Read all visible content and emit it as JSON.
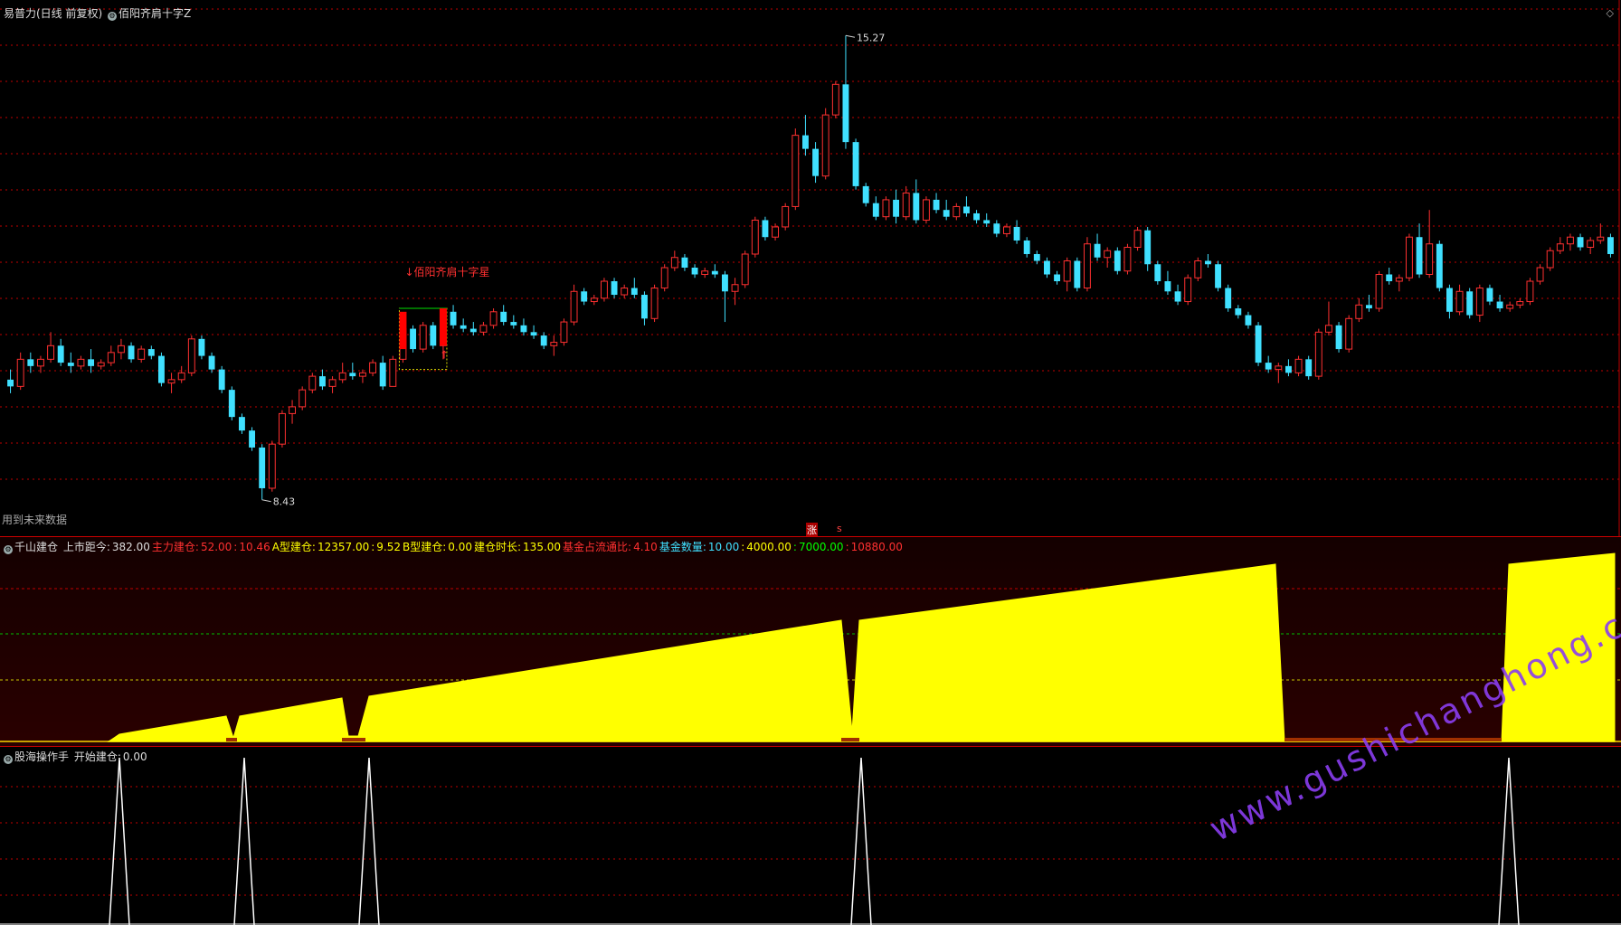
{
  "panel1": {
    "title": "易普力(日线 前复权)",
    "indicator": "佰阳齐肩十字Z",
    "future_note": "用到未来数据",
    "signal_label": "↓佰阳齐肩十字星",
    "high_label": "15.27",
    "low_label": "8.43",
    "zhang": "涨",
    "s_mark": "s"
  },
  "panel2": {
    "name": "千山建仓",
    "items": [
      {
        "label": "上市距今:",
        "value": "382.00",
        "color": "#dddddd"
      },
      {
        "label": "主力建仓:",
        "value": "52.00",
        "color": "#ff3030"
      },
      {
        "label": ":",
        "value": "10.46",
        "color": "#ff3030"
      },
      {
        "label": "A型建仓:",
        "value": "12357.00",
        "color": "#ffff00"
      },
      {
        "label": ":",
        "value": "9.52",
        "color": "#ffff00"
      },
      {
        "label": "B型建仓:",
        "value": "0.00",
        "color": "#ffff00"
      },
      {
        "label": "建仓时长:",
        "value": "135.00",
        "color": "#ffff00"
      },
      {
        "label": "基金占流通比:",
        "value": "4.10",
        "color": "#ff3030"
      },
      {
        "label": "基金数量:",
        "value": "10.00",
        "color": "#40e0ff"
      },
      {
        "label": ":",
        "value": "4000.00",
        "color": "#ffff00"
      },
      {
        "label": ":",
        "value": "7000.00",
        "color": "#00ff00"
      },
      {
        "label": ":",
        "value": "10880.00",
        "color": "#ff3030"
      }
    ]
  },
  "panel3": {
    "name": "股海操作手",
    "label": "开始建仓:",
    "value": "0.00"
  },
  "watermark": "www.gushichanghong.com",
  "colors": {
    "up": "#ff3030",
    "down": "#40e0ff",
    "fill": "#ffff00",
    "grid": "#c00000"
  },
  "chart_data": [
    {
      "type": "candlestick",
      "ylim": [
        8.2,
        15.5
      ],
      "annotations": [
        {
          "label": "15.27",
          "value": 15.27
        },
        {
          "label": "8.43",
          "value": 8.43
        }
      ],
      "candles": [
        [
          10.2,
          10.35,
          10.0,
          10.1
        ],
        [
          10.1,
          10.6,
          10.05,
          10.5
        ],
        [
          10.5,
          10.6,
          10.3,
          10.4
        ],
        [
          10.4,
          10.55,
          10.3,
          10.5
        ],
        [
          10.5,
          10.9,
          10.45,
          10.7
        ],
        [
          10.7,
          10.8,
          10.4,
          10.45
        ],
        [
          10.45,
          10.6,
          10.3,
          10.4
        ],
        [
          10.4,
          10.55,
          10.35,
          10.5
        ],
        [
          10.5,
          10.65,
          10.3,
          10.4
        ],
        [
          10.4,
          10.5,
          10.35,
          10.45
        ],
        [
          10.45,
          10.7,
          10.4,
          10.6
        ],
        [
          10.6,
          10.8,
          10.5,
          10.7
        ],
        [
          10.7,
          10.75,
          10.45,
          10.5
        ],
        [
          10.5,
          10.7,
          10.45,
          10.65
        ],
        [
          10.65,
          10.7,
          10.5,
          10.55
        ],
        [
          10.55,
          10.6,
          10.1,
          10.15
        ],
        [
          10.15,
          10.3,
          10.0,
          10.2
        ],
        [
          10.2,
          10.4,
          10.15,
          10.3
        ],
        [
          10.3,
          10.85,
          10.25,
          10.8
        ],
        [
          10.8,
          10.85,
          10.5,
          10.55
        ],
        [
          10.55,
          10.6,
          10.3,
          10.35
        ],
        [
          10.35,
          10.4,
          10.0,
          10.05
        ],
        [
          10.05,
          10.1,
          9.6,
          9.65
        ],
        [
          9.65,
          9.7,
          9.4,
          9.45
        ],
        [
          9.45,
          9.5,
          9.15,
          9.2
        ],
        [
          9.2,
          9.25,
          8.43,
          8.6
        ],
        [
          8.6,
          9.3,
          8.55,
          9.25
        ],
        [
          9.25,
          9.75,
          9.2,
          9.7
        ],
        [
          9.7,
          9.9,
          9.55,
          9.8
        ],
        [
          9.8,
          10.1,
          9.75,
          10.05
        ],
        [
          10.05,
          10.3,
          10.0,
          10.25
        ],
        [
          10.25,
          10.35,
          10.05,
          10.1
        ],
        [
          10.1,
          10.25,
          10.0,
          10.2
        ],
        [
          10.2,
          10.45,
          10.15,
          10.3
        ],
        [
          10.3,
          10.45,
          10.2,
          10.25
        ],
        [
          10.25,
          10.35,
          10.15,
          10.3
        ],
        [
          10.3,
          10.5,
          10.25,
          10.45
        ],
        [
          10.45,
          10.55,
          10.05,
          10.1
        ],
        [
          10.1,
          10.55,
          10.1,
          10.5
        ],
        [
          10.5,
          11.0,
          10.45,
          10.95
        ],
        [
          10.95,
          11.0,
          10.6,
          10.65
        ],
        [
          10.65,
          11.05,
          10.6,
          11.0
        ],
        [
          11.0,
          11.05,
          10.65,
          10.7
        ],
        [
          10.7,
          11.25,
          10.5,
          11.2
        ],
        [
          11.2,
          11.3,
          10.95,
          11.0
        ],
        [
          11.0,
          11.1,
          10.9,
          10.95
        ],
        [
          10.95,
          11.05,
          10.85,
          10.9
        ],
        [
          10.9,
          11.05,
          10.85,
          11.0
        ],
        [
          11.0,
          11.25,
          10.95,
          11.2
        ],
        [
          11.2,
          11.3,
          11.0,
          11.05
        ],
        [
          11.05,
          11.15,
          10.95,
          11.0
        ],
        [
          11.0,
          11.1,
          10.85,
          10.9
        ],
        [
          10.9,
          11.0,
          10.8,
          10.85
        ],
        [
          10.85,
          10.9,
          10.65,
          10.7
        ],
        [
          10.7,
          10.85,
          10.55,
          10.75
        ],
        [
          10.75,
          11.1,
          10.7,
          11.05
        ],
        [
          11.05,
          11.6,
          11.0,
          11.5
        ],
        [
          11.5,
          11.55,
          11.3,
          11.35
        ],
        [
          11.35,
          11.45,
          11.3,
          11.4
        ],
        [
          11.4,
          11.7,
          11.35,
          11.65
        ],
        [
          11.65,
          11.7,
          11.4,
          11.45
        ],
        [
          11.45,
          11.6,
          11.4,
          11.55
        ],
        [
          11.55,
          11.7,
          11.4,
          11.45
        ],
        [
          11.45,
          11.5,
          11.0,
          11.1
        ],
        [
          11.1,
          11.6,
          11.05,
          11.55
        ],
        [
          11.55,
          11.9,
          11.5,
          11.85
        ],
        [
          11.85,
          12.1,
          11.8,
          12.0
        ],
        [
          12.0,
          12.05,
          11.8,
          11.85
        ],
        [
          11.85,
          11.9,
          11.7,
          11.75
        ],
        [
          11.75,
          11.85,
          11.7,
          11.8
        ],
        [
          11.8,
          11.9,
          11.7,
          11.75
        ],
        [
          11.75,
          11.8,
          11.05,
          11.5
        ],
        [
          11.5,
          11.7,
          11.3,
          11.6
        ],
        [
          11.6,
          12.1,
          11.55,
          12.05
        ],
        [
          12.05,
          12.6,
          12.0,
          12.55
        ],
        [
          12.55,
          12.6,
          12.25,
          12.3
        ],
        [
          12.3,
          12.5,
          12.25,
          12.45
        ],
        [
          12.45,
          12.8,
          12.4,
          12.75
        ],
        [
          12.75,
          13.9,
          12.7,
          13.8
        ],
        [
          13.8,
          14.1,
          13.5,
          13.6
        ],
        [
          13.6,
          13.7,
          13.1,
          13.2
        ],
        [
          13.2,
          14.2,
          13.15,
          14.1
        ],
        [
          14.1,
          14.6,
          14.05,
          14.55
        ],
        [
          14.55,
          15.27,
          13.6,
          13.7
        ],
        [
          13.7,
          13.75,
          13.0,
          13.05
        ],
        [
          13.05,
          13.1,
          12.75,
          12.8
        ],
        [
          12.8,
          12.9,
          12.55,
          12.6
        ],
        [
          12.6,
          12.9,
          12.55,
          12.85
        ],
        [
          12.85,
          13.0,
          12.5,
          12.6
        ],
        [
          12.6,
          13.05,
          12.55,
          12.95
        ],
        [
          12.95,
          13.15,
          12.5,
          12.55
        ],
        [
          12.55,
          12.9,
          12.5,
          12.85
        ],
        [
          12.85,
          12.95,
          12.65,
          12.7
        ],
        [
          12.7,
          12.85,
          12.55,
          12.6
        ],
        [
          12.6,
          12.8,
          12.55,
          12.75
        ],
        [
          12.75,
          12.9,
          12.6,
          12.65
        ],
        [
          12.65,
          12.7,
          12.5,
          12.55
        ],
        [
          12.55,
          12.65,
          12.45,
          12.5
        ],
        [
          12.5,
          12.55,
          12.3,
          12.35
        ],
        [
          12.35,
          12.5,
          12.3,
          12.45
        ],
        [
          12.45,
          12.55,
          12.2,
          12.25
        ],
        [
          12.25,
          12.3,
          12.0,
          12.05
        ],
        [
          12.05,
          12.1,
          11.9,
          11.95
        ],
        [
          11.95,
          12.0,
          11.7,
          11.75
        ],
        [
          11.75,
          11.8,
          11.6,
          11.65
        ],
        [
          11.65,
          12.0,
          11.5,
          11.95
        ],
        [
          11.95,
          12.0,
          11.5,
          11.55
        ],
        [
          11.55,
          12.3,
          11.5,
          12.2
        ],
        [
          12.2,
          12.35,
          11.95,
          12.0
        ],
        [
          12.0,
          12.15,
          11.85,
          12.1
        ],
        [
          12.1,
          12.15,
          11.75,
          11.8
        ],
        [
          11.8,
          12.2,
          11.75,
          12.15
        ],
        [
          12.15,
          12.45,
          12.1,
          12.4
        ],
        [
          12.4,
          12.45,
          11.8,
          11.9
        ],
        [
          11.9,
          11.95,
          11.6,
          11.65
        ],
        [
          11.65,
          11.8,
          11.45,
          11.5
        ],
        [
          11.5,
          11.6,
          11.3,
          11.35
        ],
        [
          11.35,
          11.75,
          11.3,
          11.7
        ],
        [
          11.7,
          12.0,
          11.65,
          11.95
        ],
        [
          11.95,
          12.05,
          11.85,
          11.9
        ],
        [
          11.9,
          11.95,
          11.5,
          11.55
        ],
        [
          11.55,
          11.6,
          11.2,
          11.25
        ],
        [
          11.25,
          11.3,
          11.1,
          11.15
        ],
        [
          11.15,
          11.2,
          10.95,
          11.0
        ],
        [
          11.0,
          11.05,
          10.4,
          10.45
        ],
        [
          10.45,
          10.55,
          10.3,
          10.35
        ],
        [
          10.35,
          10.45,
          10.15,
          10.4
        ],
        [
          10.4,
          10.5,
          10.25,
          10.3
        ],
        [
          10.3,
          10.55,
          10.25,
          10.5
        ],
        [
          10.5,
          10.55,
          10.2,
          10.25
        ],
        [
          10.25,
          10.95,
          10.2,
          10.9
        ],
        [
          10.9,
          11.35,
          10.85,
          11.0
        ],
        [
          11.0,
          11.05,
          10.6,
          10.65
        ],
        [
          10.65,
          11.15,
          10.6,
          11.1
        ],
        [
          11.1,
          11.4,
          11.05,
          11.3
        ],
        [
          11.3,
          11.45,
          11.2,
          11.25
        ],
        [
          11.25,
          11.8,
          11.2,
          11.75
        ],
        [
          11.75,
          11.85,
          11.6,
          11.65
        ],
        [
          11.65,
          11.75,
          11.5,
          11.7
        ],
        [
          11.7,
          12.35,
          11.65,
          12.3
        ],
        [
          12.3,
          12.5,
          11.7,
          11.75
        ],
        [
          11.75,
          12.7,
          11.7,
          12.2
        ],
        [
          12.2,
          12.25,
          11.5,
          11.55
        ],
        [
          11.55,
          11.6,
          11.1,
          11.2
        ],
        [
          11.2,
          11.6,
          11.15,
          11.5
        ],
        [
          11.5,
          11.55,
          11.1,
          11.15
        ],
        [
          11.15,
          11.6,
          11.05,
          11.55
        ],
        [
          11.55,
          11.6,
          11.3,
          11.35
        ],
        [
          11.35,
          11.45,
          11.2,
          11.25
        ],
        [
          11.25,
          11.35,
          11.2,
          11.3
        ],
        [
          11.3,
          11.4,
          11.25,
          11.35
        ],
        [
          11.35,
          11.7,
          11.3,
          11.65
        ],
        [
          11.65,
          11.9,
          11.6,
          11.85
        ],
        [
          11.85,
          12.15,
          11.8,
          12.1
        ],
        [
          12.1,
          12.3,
          12.05,
          12.2
        ],
        [
          12.2,
          12.35,
          12.1,
          12.3
        ],
        [
          12.3,
          12.35,
          12.1,
          12.15
        ],
        [
          12.15,
          12.3,
          12.05,
          12.25
        ],
        [
          12.25,
          12.5,
          12.2,
          12.3
        ],
        [
          12.3,
          12.35,
          12.0,
          12.05
        ]
      ]
    },
    {
      "type": "area",
      "series": [
        {
          "values": [
            0,
            0,
            0,
            0,
            0,
            0,
            0,
            0,
            0,
            0,
            0,
            0,
            0,
            0,
            0,
            0,
            0,
            0,
            0,
            0,
            0,
            0,
            0,
            0,
            0,
            0,
            0,
            0,
            0,
            0,
            0,
            0,
            0,
            0,
            0,
            0,
            0,
            0,
            0,
            0,
            0,
            0,
            0,
            0,
            0,
            0,
            0,
            0,
            0,
            0,
            0,
            0,
            0,
            0,
            0,
            0,
            0,
            0,
            0,
            0,
            0,
            0,
            0,
            0,
            0,
            0,
            0,
            0,
            0,
            0,
            0,
            0,
            0,
            0,
            0,
            0,
            0,
            0,
            0,
            0,
            0,
            0,
            0,
            0,
            0,
            0,
            0,
            0,
            0,
            0,
            0,
            0,
            0,
            0,
            0,
            0,
            0,
            0,
            0,
            0,
            0,
            0,
            0,
            0,
            0,
            0,
            0,
            0,
            0,
            0,
            0,
            0,
            0,
            0,
            0,
            0,
            0,
            0,
            0,
            0,
            0,
            0,
            0,
            0,
            0,
            0,
            0,
            0,
            0,
            0,
            0,
            0,
            0,
            0,
            0,
            0,
            0,
            0,
            0,
            0,
            0,
            0,
            0,
            0,
            0,
            0,
            0,
            0,
            0,
            0,
            0,
            0,
            0,
            0,
            0,
            0,
            0,
            0,
            0,
            0
          ]
        }
      ]
    },
    {
      "type": "line",
      "spikes_at": [
        11,
        23,
        35,
        83,
        145
      ]
    }
  ]
}
